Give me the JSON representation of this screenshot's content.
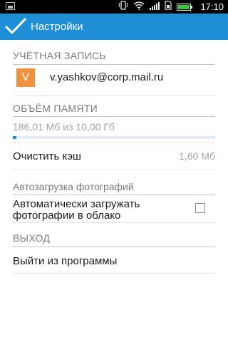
{
  "status_bar": {
    "time": "17:10",
    "icons": [
      "image-notification-icon",
      "vibrate-icon",
      "wifi-icon",
      "signal-icon",
      "sim-icon",
      "battery-icon"
    ]
  },
  "action_bar": {
    "title": "Настройки",
    "background": "#1e8ed6"
  },
  "account": {
    "header": "УЧЁТНАЯ ЗАПИСЬ",
    "avatar_letter": "V",
    "avatar_color": "#f0913f",
    "email": "v.yashkov@corp.mail.ru"
  },
  "storage": {
    "header": "ОБЪЁМ ПАМЯТИ",
    "usage_text": "186,01 Мб из 10,00 Гб",
    "usage_fraction": 0.018,
    "clear_cache_label": "Очистить кэш",
    "cache_size": "1,60 Мб"
  },
  "photo_upload": {
    "header": "Автозагрузка фотографий",
    "auto_upload_label_line1": "Автоматически загружать",
    "auto_upload_label_line2": "фотографии в облако",
    "auto_upload_checked": false
  },
  "exit": {
    "header": "ВЫХОД",
    "logout_label": "Выйти из программы"
  }
}
